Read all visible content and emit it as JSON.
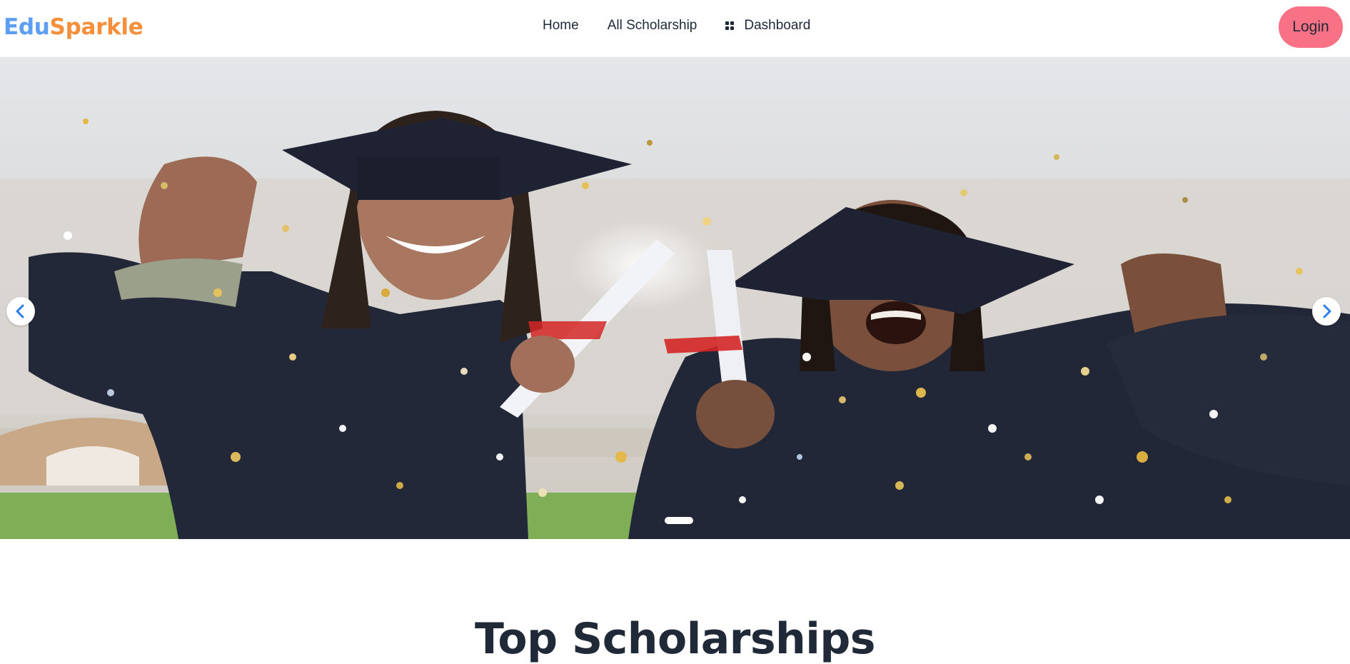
{
  "brand": {
    "part1": "Edu",
    "part2": "Sparkle"
  },
  "nav": {
    "home": "Home",
    "all_scholarship": "All Scholarship",
    "dashboard": "Dashboard",
    "dashboard_icon": "dashboard-grid-icon"
  },
  "login_label": "Login",
  "hero": {
    "image": "graduation-celebration-photo",
    "prev_icon": "chevron-left-icon",
    "next_icon": "chevron-right-icon"
  },
  "section_title": "Top Scholarships",
  "colors": {
    "brand_edu": "#5b9ef2",
    "brand_sparkle": "#f58f3c",
    "login_bg": "#f87184",
    "arrow_blue": "#2b7de9",
    "text_dark": "#1f2937"
  }
}
